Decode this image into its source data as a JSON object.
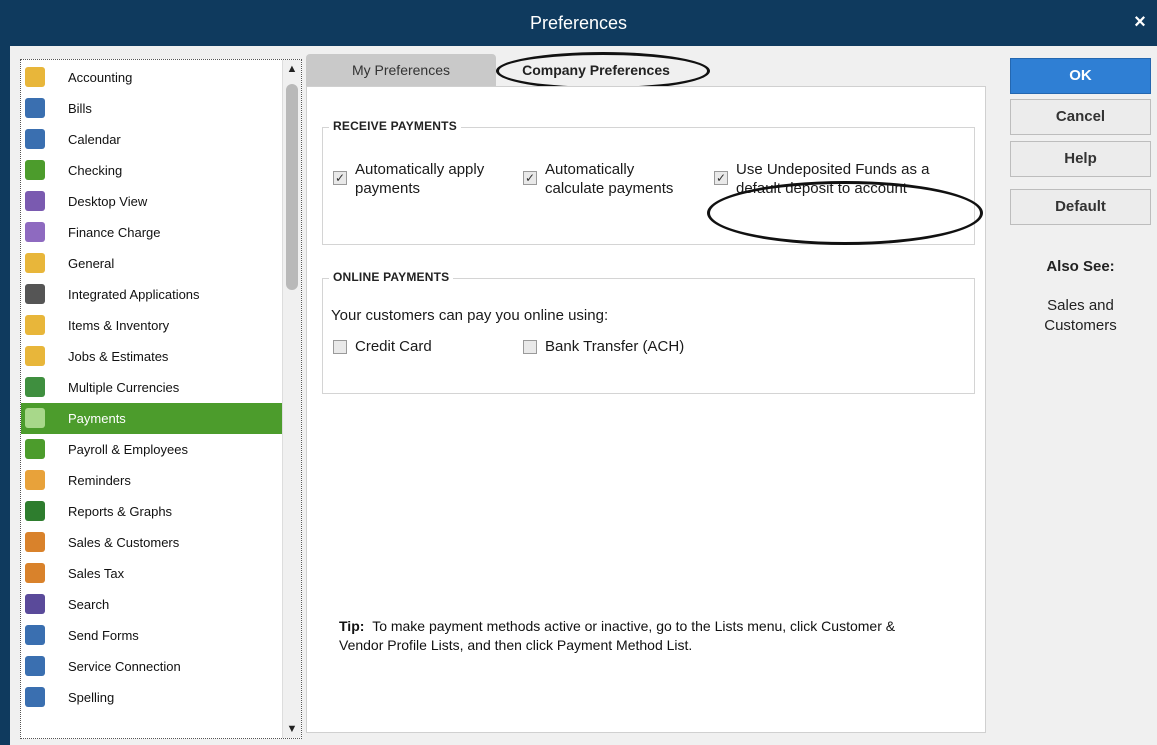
{
  "window": {
    "title": "Preferences",
    "close_glyph": "×"
  },
  "categories": [
    {
      "label": "Accounting",
      "icon": "accounting-icon",
      "color": "#e8b63a"
    },
    {
      "label": "Bills",
      "icon": "bills-icon",
      "color": "#3a6fb0"
    },
    {
      "label": "Calendar",
      "icon": "calendar-icon",
      "color": "#3a6fb0"
    },
    {
      "label": "Checking",
      "icon": "checking-icon",
      "color": "#4c9c2c"
    },
    {
      "label": "Desktop View",
      "icon": "desktop-view-icon",
      "color": "#7a5ab0"
    },
    {
      "label": "Finance Charge",
      "icon": "finance-charge-icon",
      "color": "#8e6ac0"
    },
    {
      "label": "General",
      "icon": "general-icon",
      "color": "#e8b63a"
    },
    {
      "label": "Integrated Applications",
      "icon": "integrated-apps-icon",
      "color": "#555555"
    },
    {
      "label": "Items & Inventory",
      "icon": "items-inventory-icon",
      "color": "#e8b63a"
    },
    {
      "label": "Jobs & Estimates",
      "icon": "jobs-estimates-icon",
      "color": "#e8b63a"
    },
    {
      "label": "Multiple Currencies",
      "icon": "multiple-currencies-icon",
      "color": "#3f8f3f"
    },
    {
      "label": "Payments",
      "icon": "payments-icon",
      "color": "#a8d88a",
      "selected": true
    },
    {
      "label": "Payroll & Employees",
      "icon": "payroll-icon",
      "color": "#4c9c2c"
    },
    {
      "label": "Reminders",
      "icon": "reminders-icon",
      "color": "#e8a23a"
    },
    {
      "label": "Reports & Graphs",
      "icon": "reports-graphs-icon",
      "color": "#2e7d2e"
    },
    {
      "label": "Sales & Customers",
      "icon": "sales-customers-icon",
      "color": "#d9822b"
    },
    {
      "label": "Sales Tax",
      "icon": "sales-tax-icon",
      "color": "#d9822b"
    },
    {
      "label": "Search",
      "icon": "search-icon",
      "color": "#5a4a9a"
    },
    {
      "label": "Send Forms",
      "icon": "send-forms-icon",
      "color": "#3a6fb0"
    },
    {
      "label": "Service Connection",
      "icon": "service-connection-icon",
      "color": "#3a6fb0"
    },
    {
      "label": "Spelling",
      "icon": "spelling-icon",
      "color": "#3a6fb0"
    }
  ],
  "tabs": {
    "my_preferences": "My Preferences",
    "company_preferences": "Company Preferences"
  },
  "receive_payments": {
    "heading": "RECEIVE PAYMENTS",
    "auto_apply": {
      "line1": "Automatically apply",
      "line2": "payments",
      "checked": true
    },
    "auto_calc": {
      "line1": "Automatically",
      "line2": "calculate payments",
      "checked": true
    },
    "undeposited": {
      "line1": "Use Undeposited Funds as a",
      "line2": "default deposit to account",
      "checked": true
    }
  },
  "online_payments": {
    "heading": "ONLINE PAYMENTS",
    "intro": "Your customers can pay you online using:",
    "credit_card": {
      "label": "Credit Card",
      "checked": false
    },
    "bank_transfer": {
      "label": "Bank Transfer (ACH)",
      "checked": false
    }
  },
  "tip": {
    "prefix": "Tip:",
    "text": "To make payment methods active or inactive, go to the Lists menu, click Customer & Vendor Profile Lists, and then click Payment Method List."
  },
  "buttons": {
    "ok": "OK",
    "cancel": "Cancel",
    "help": "Help",
    "default": "Default"
  },
  "also_see": {
    "heading": "Also See:",
    "link_line1": "Sales and",
    "link_line2": "Customers"
  },
  "colors": {
    "title_bar": "#0f3a5e",
    "selected_item": "#4c9c2c",
    "ok_button": "#2f7fd4"
  }
}
